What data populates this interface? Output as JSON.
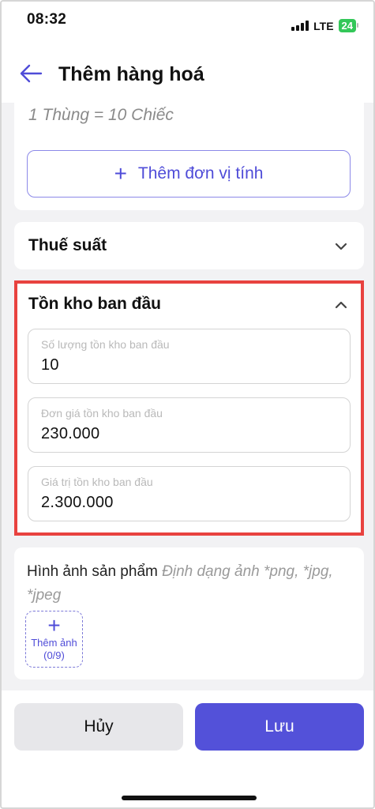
{
  "status": {
    "time": "08:32",
    "network": "LTE",
    "battery": "24"
  },
  "header": {
    "title": "Thêm hàng hoá",
    "back_icon": "arrow-left-icon"
  },
  "units": {
    "conversion": "1 Thùng = 10 Chiếc",
    "add_unit_label": "Thêm đơn vị tính"
  },
  "tax": {
    "title": "Thuế suất",
    "expanded": false
  },
  "stock": {
    "title": "Tồn kho ban đầu",
    "expanded": true,
    "fields": [
      {
        "label": "Số lượng tồn kho ban đầu",
        "value": "10"
      },
      {
        "label": "Đơn giá tồn kho ban đầu",
        "value": "230.000"
      },
      {
        "label": "Giá trị tồn kho ban đầu",
        "value": "2.300.000"
      }
    ]
  },
  "images": {
    "title": "Hình ảnh sản phẩm",
    "hint": "Định dạng ảnh *png, *jpg, *jpeg",
    "add_label": "Thêm ảnh",
    "count": "(0/9)"
  },
  "actions": {
    "cancel": "Hủy",
    "save": "Lưu"
  },
  "colors": {
    "accent": "#5351d9",
    "highlight": "#e8423f",
    "battery": "#34c759"
  }
}
